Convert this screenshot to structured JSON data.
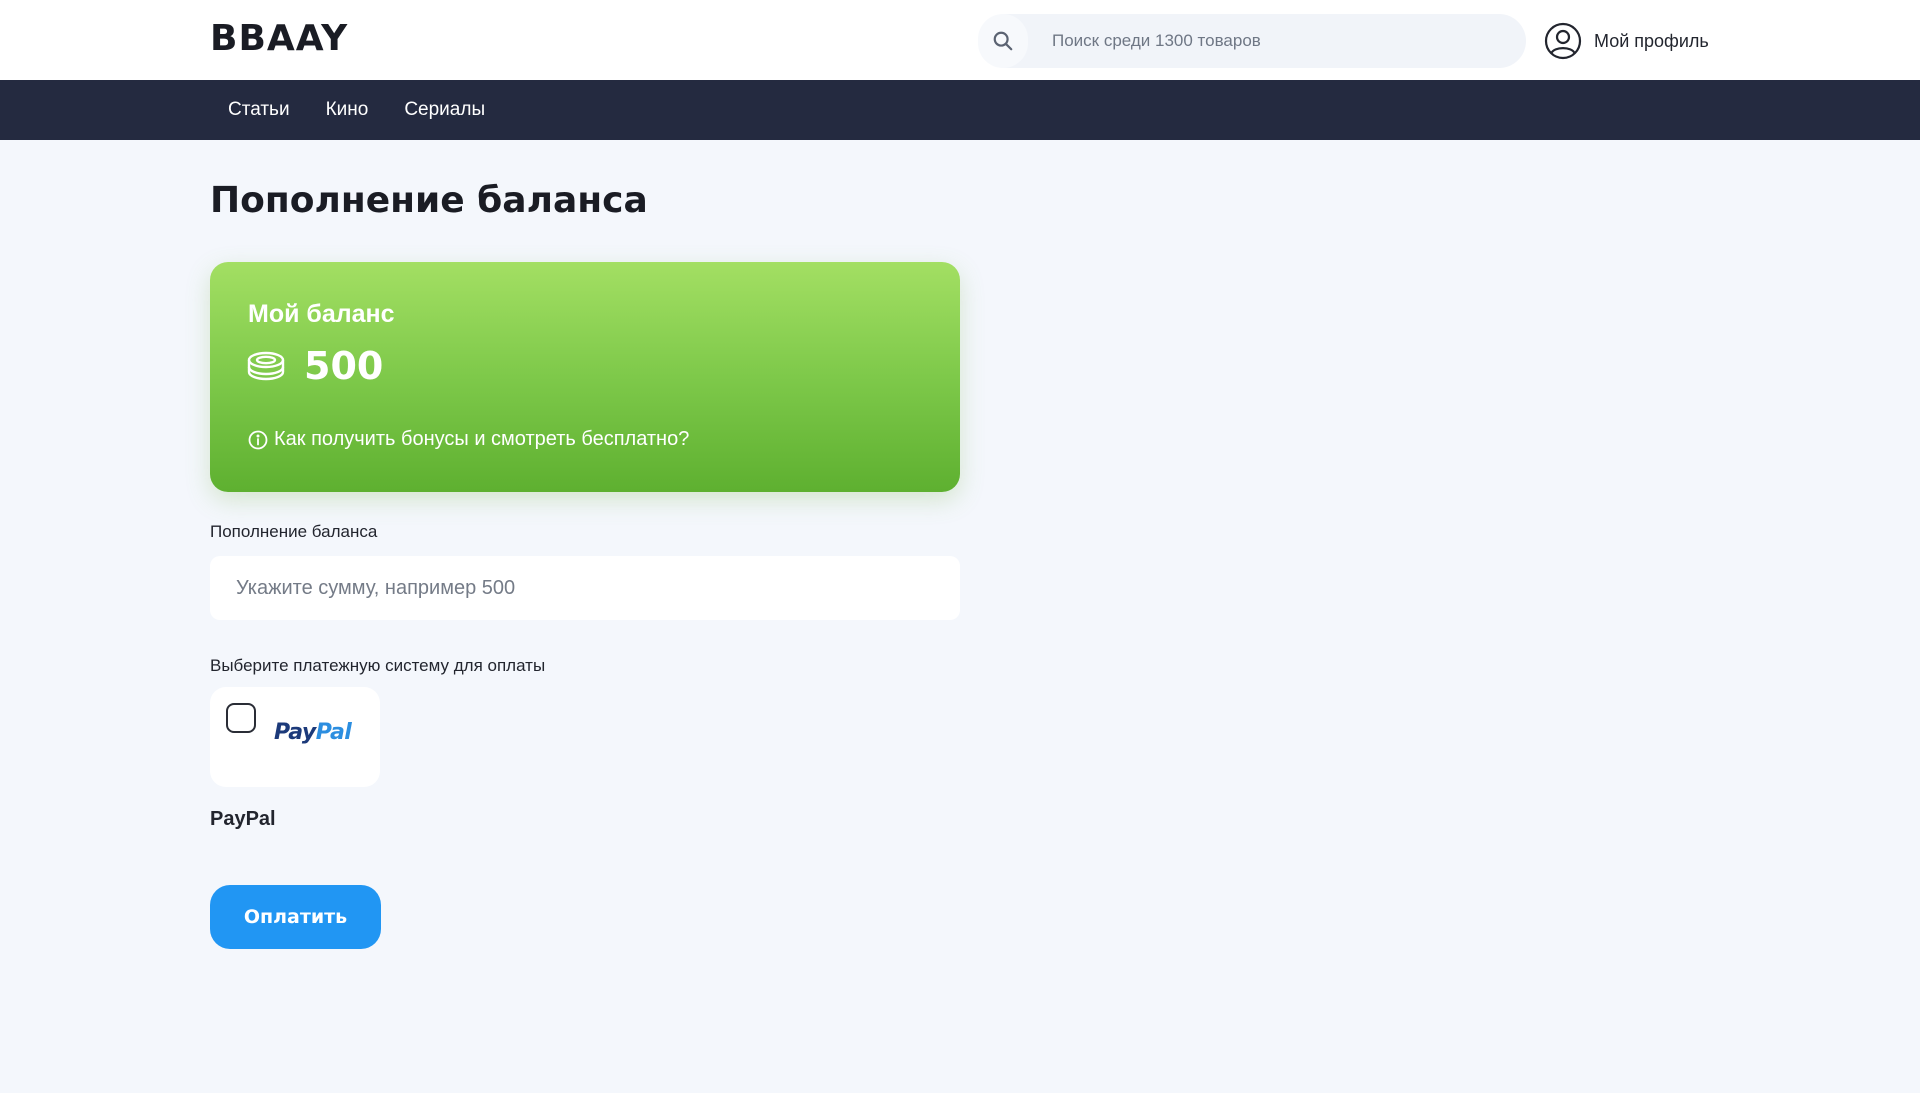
{
  "header": {
    "logo": "BBAAY",
    "search": {
      "placeholder": "Поиск среди 1300 товаров",
      "icon": "search-icon"
    },
    "profile": {
      "label": "Мой профиль",
      "icon": "user-circle-icon"
    }
  },
  "nav": {
    "items": [
      {
        "label": "Статьи"
      },
      {
        "label": "Кино"
      },
      {
        "label": "Сериалы"
      }
    ]
  },
  "main": {
    "title": "Пополнение баланса",
    "balance_card": {
      "title": "Мой баланс",
      "amount": "500",
      "coin_icon": "coins-icon",
      "bonus_link": "Как получить бонусы и смотреть бесплатно?",
      "info_icon": "info-icon"
    },
    "topup": {
      "label": "Пополнение баланса",
      "placeholder": "Укажите сумму, например 500"
    },
    "payment": {
      "label": "Выберите платежную систему для оплаты",
      "options": [
        {
          "name": "PayPal",
          "logo_pay": "Pay",
          "logo_pal": "Pal",
          "checked": false
        }
      ]
    },
    "pay_button": "Оплатить"
  },
  "colors": {
    "nav_bg": "#242a40",
    "page_bg": "#f4f7fc",
    "card_gradient_top": "#a3df63",
    "card_gradient_bottom": "#5eb030",
    "button": "#2196f3",
    "paypal_dark": "#1c3a7a",
    "paypal_light": "#2c8ee0"
  }
}
